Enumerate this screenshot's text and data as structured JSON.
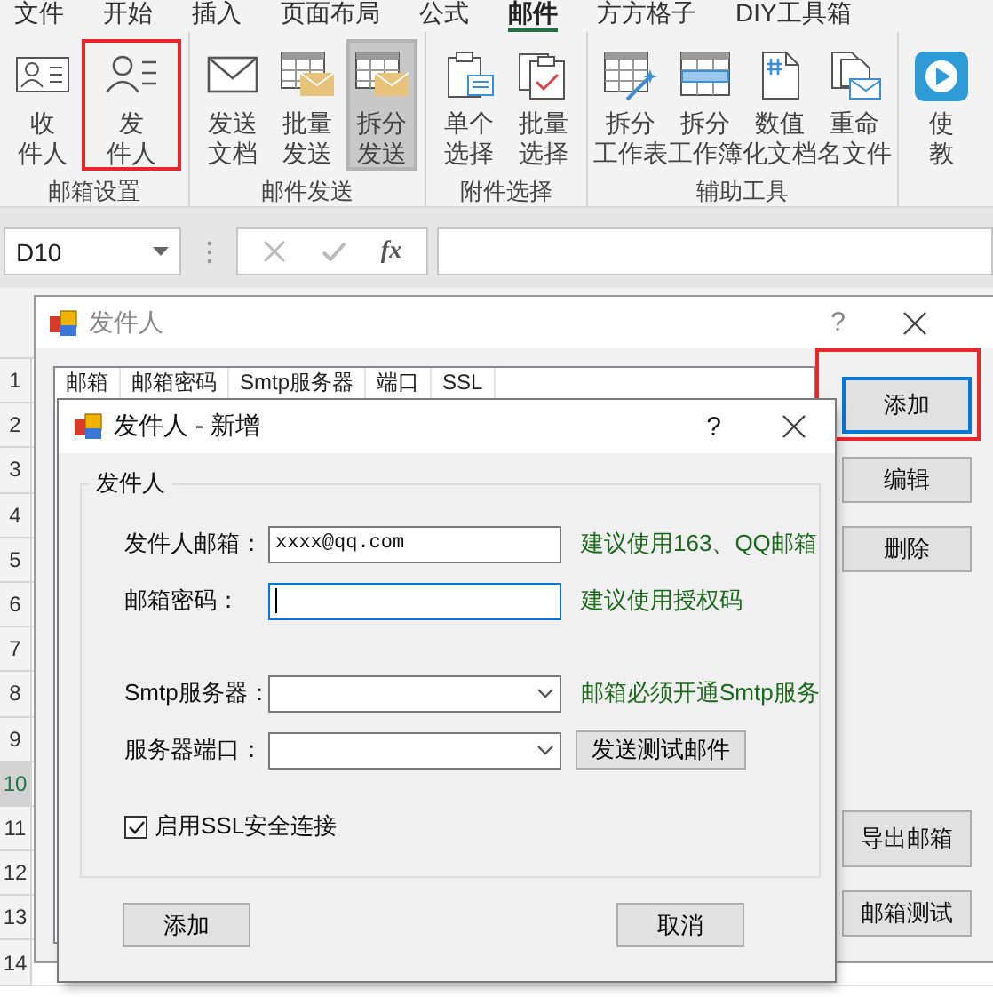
{
  "menu_tabs": [
    {
      "label": "文件",
      "selected": false
    },
    {
      "label": "开始",
      "selected": false
    },
    {
      "label": "插入",
      "selected": false
    },
    {
      "label": "页面布局",
      "selected": false
    },
    {
      "label": "公式",
      "selected": false
    },
    {
      "label": "邮件",
      "selected": true
    },
    {
      "label": "方方格子",
      "selected": false
    },
    {
      "label": "DIY工具箱",
      "selected": false
    }
  ],
  "ribbon": {
    "groups": [
      {
        "label": "邮箱设置",
        "buttons": [
          {
            "lines": [
              "收",
              "件人"
            ],
            "pressed": false,
            "highlighted": false
          },
          {
            "lines": [
              "发",
              "件人"
            ],
            "pressed": false,
            "highlighted": true
          }
        ]
      },
      {
        "label": "邮件发送",
        "buttons": [
          {
            "lines": [
              "发送",
              "文档"
            ],
            "pressed": false,
            "highlighted": false
          },
          {
            "lines": [
              "批量",
              "发送"
            ],
            "pressed": false,
            "highlighted": false
          },
          {
            "lines": [
              "拆分",
              "发送"
            ],
            "pressed": true,
            "highlighted": false
          }
        ]
      },
      {
        "label": "附件选择",
        "buttons": [
          {
            "lines": [
              "单个",
              "选择"
            ],
            "pressed": false,
            "highlighted": false
          },
          {
            "lines": [
              "批量",
              "选择"
            ],
            "pressed": false,
            "highlighted": false
          }
        ]
      },
      {
        "label": "辅助工具",
        "buttons": [
          {
            "lines": [
              "拆分",
              "工作表"
            ],
            "pressed": false,
            "highlighted": false
          },
          {
            "lines": [
              "拆分",
              "工作簿"
            ],
            "pressed": false,
            "highlighted": false
          },
          {
            "lines": [
              "数值",
              "化文档"
            ],
            "pressed": false,
            "highlighted": false
          },
          {
            "lines": [
              "重命",
              "名文件"
            ],
            "pressed": false,
            "highlighted": false
          }
        ]
      },
      {
        "buttons": [
          {
            "lines": [
              "使",
              "教"
            ],
            "pressed": false,
            "highlighted": false
          }
        ]
      }
    ]
  },
  "formula_bar": {
    "name_box": "D10",
    "function_label": "fx"
  },
  "sheet": {
    "rows": [
      {
        "number": "1",
        "selected": false
      },
      {
        "number": "2",
        "selected": false
      },
      {
        "number": "3",
        "selected": false
      },
      {
        "number": "4",
        "selected": false
      },
      {
        "number": "5",
        "selected": false
      },
      {
        "number": "6",
        "selected": false
      },
      {
        "number": "7",
        "selected": false
      },
      {
        "number": "8",
        "selected": false
      },
      {
        "number": "9",
        "selected": false
      },
      {
        "number": "10",
        "selected": true
      },
      {
        "number": "11",
        "selected": false
      },
      {
        "number": "12",
        "selected": false
      },
      {
        "number": "13",
        "selected": false
      },
      {
        "number": "14",
        "selected": false
      }
    ]
  },
  "list_dialog": {
    "title": "发件人",
    "help": "?",
    "columns": [
      "邮箱",
      "邮箱密码",
      "Smtp服务器",
      "端口",
      "SSL"
    ],
    "buttons": [
      {
        "label": "添加",
        "focused": true,
        "highlighted": true
      },
      {
        "label": "编辑",
        "focused": false,
        "highlighted": false
      },
      {
        "label": "删除",
        "focused": false,
        "highlighted": false
      }
    ],
    "lower_buttons": [
      {
        "label": "导出邮箱",
        "focused": false,
        "highlighted": false
      },
      {
        "label": "邮箱测试",
        "focused": false,
        "highlighted": false
      }
    ]
  },
  "edit_dialog": {
    "title": "发件人 - 新增",
    "help": "?",
    "group_label": "发件人",
    "fields": [
      {
        "kind": "text",
        "label": "发件人邮箱：",
        "value": "xxxx@qq.com",
        "focused": false,
        "hint": "建议使用163、QQ邮箱"
      },
      {
        "kind": "text",
        "label": "邮箱密码：",
        "focused": true,
        "hint": "建议使用授权码"
      },
      {
        "kind": "dropdown",
        "label": "Smtp服务器：",
        "hint": "邮箱必须开通Smtp服务"
      },
      {
        "kind": "dropdown",
        "label": "服务器端口：",
        "button": "发送测试邮件"
      }
    ],
    "ssl_checkbox": {
      "label": "启用SSL安全连接",
      "checked": true
    },
    "buttons": [
      "添加",
      "取消"
    ]
  }
}
